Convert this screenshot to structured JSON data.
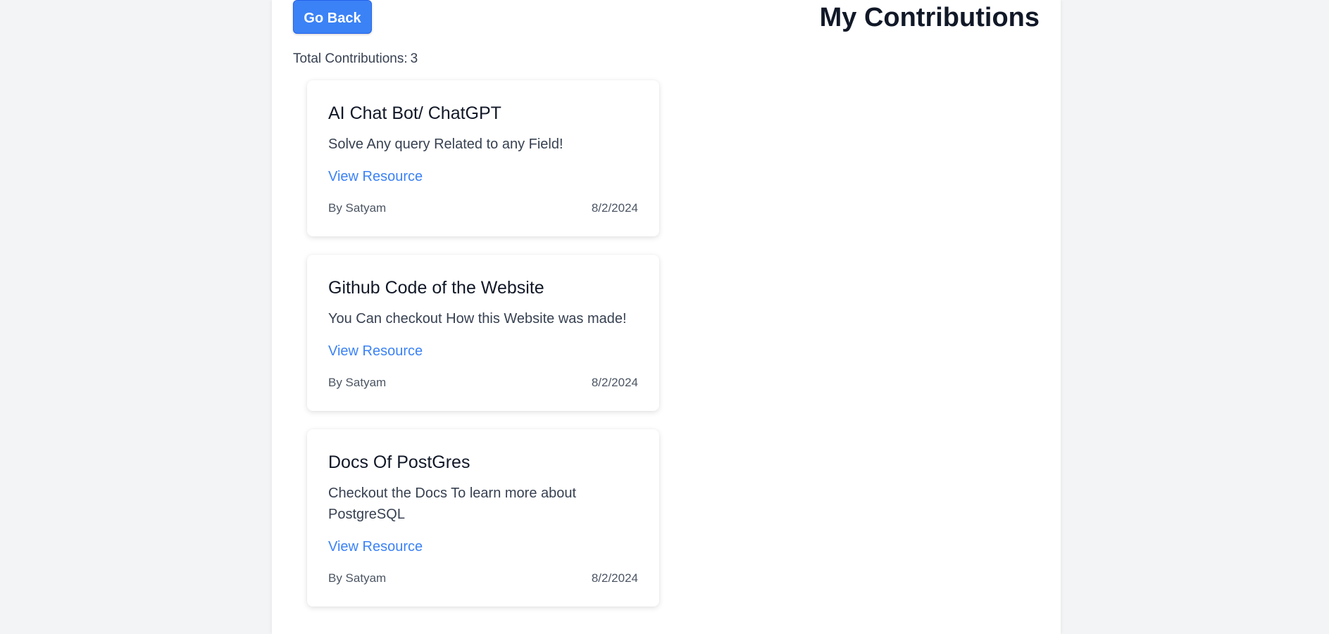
{
  "header": {
    "back_label": "Go Back",
    "title": "My Contributions"
  },
  "summary": {
    "total_label": "Total Contributions:",
    "total_count": "3"
  },
  "contributions": [
    {
      "title": "AI Chat Bot/ ChatGPT",
      "description": "Solve Any query Related to any Field!",
      "link_label": "View Resource",
      "author": "By Satyam",
      "date": "8/2/2024"
    },
    {
      "title": "Github Code of the Website",
      "description": "You Can checkout How this Website was made!",
      "link_label": "View Resource",
      "author": "By Satyam",
      "date": "8/2/2024"
    },
    {
      "title": "Docs Of PostGres",
      "description": "Checkout the Docs To learn more about PostgreSQL",
      "link_label": "View Resource",
      "author": "By Satyam",
      "date": "8/2/2024"
    }
  ],
  "colors": {
    "accent": "#3b82f6",
    "background": "#f3f4f6",
    "surface": "#ffffff"
  }
}
